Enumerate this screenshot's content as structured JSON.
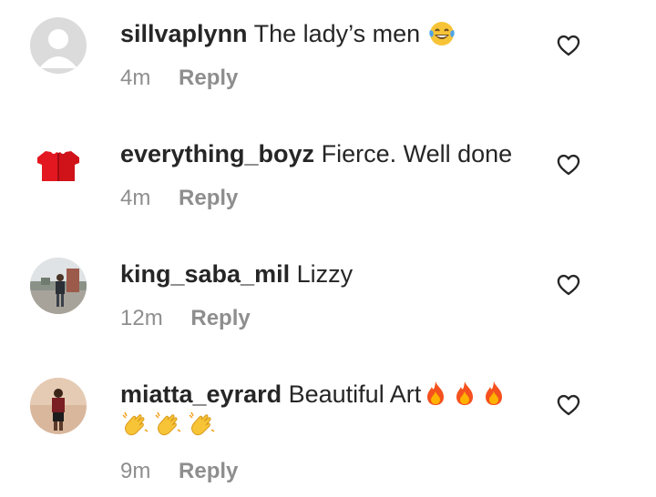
{
  "comments": [
    {
      "username": "sillvaplynn",
      "text": "The lady’s men",
      "emojis": [
        "face-with-tears-of-joy"
      ],
      "time": "4m",
      "reply_label": "Reply",
      "avatar": "default-avatar"
    },
    {
      "username": "everything_boyz",
      "text": "Fierce. Well done",
      "emojis": [],
      "time": "4m",
      "reply_label": "Reply",
      "avatar": "red-shirts"
    },
    {
      "username": "king_saba_mil",
      "text": "Lizzy",
      "emojis": [],
      "time": "12m",
      "reply_label": "Reply",
      "avatar": "person-outdoors"
    },
    {
      "username": "miatta_eyrard",
      "text": "Beautiful Art",
      "emojis": [
        "fire",
        "fire",
        "fire",
        "clapping-hands",
        "clapping-hands",
        "clapping-hands"
      ],
      "time": "9m",
      "reply_label": "Reply",
      "avatar": "person-indoors"
    }
  ],
  "icons": {
    "like": "heart-outline-icon"
  },
  "colors": {
    "text": "#262626",
    "secondary": "#8e8e8e"
  }
}
